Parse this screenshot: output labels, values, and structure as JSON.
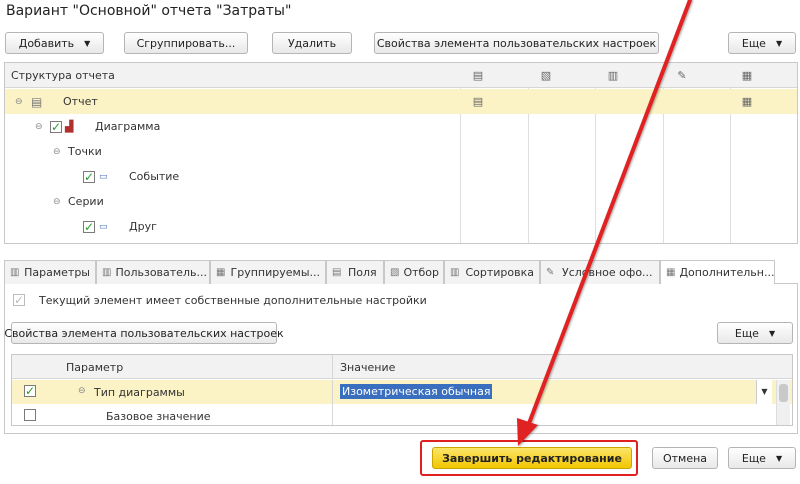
{
  "window": {
    "title": "Вариант \"Основной\" отчета \"Затраты\""
  },
  "toolbar": {
    "add_label": "Добавить",
    "group_label": "Сгруппировать...",
    "delete_label": "Удалить",
    "properties_label": "Свойства элемента пользовательских настроек",
    "more_label": "Еще"
  },
  "structure": {
    "header": "Структура отчета",
    "rows": [
      {
        "label": "Отчет"
      },
      {
        "label": "Диаграмма"
      },
      {
        "label": "Точки"
      },
      {
        "label": "Событие"
      },
      {
        "label": "Серии"
      },
      {
        "label": "Друг"
      }
    ]
  },
  "tabs": [
    {
      "label": "Параметры"
    },
    {
      "label": "Пользователь..."
    },
    {
      "label": "Группируемы..."
    },
    {
      "label": "Поля"
    },
    {
      "label": "Отбор"
    },
    {
      "label": "Сортировка"
    },
    {
      "label": "Условное офо..."
    },
    {
      "label": "Дополнительн..."
    }
  ],
  "extra": {
    "own_settings_label": "Текущий элемент имеет собственные дополнительные настройки",
    "properties_button": "Свойства элемента пользовательских настроек",
    "more_label": "Еще",
    "col_param": "Параметр",
    "col_value": "Значение",
    "rows": [
      {
        "param": "Тип диаграммы",
        "value": "Изометрическая обычная"
      },
      {
        "param": "Базовое значение",
        "value": ""
      }
    ]
  },
  "footer": {
    "finish_label": "Завершить редактирование",
    "cancel_label": "Отмена",
    "more_label": "Еще"
  },
  "colors": {
    "selected_row": "#fbf3c5",
    "primary_button": "#f7d21b",
    "arrow": "#e02020"
  }
}
